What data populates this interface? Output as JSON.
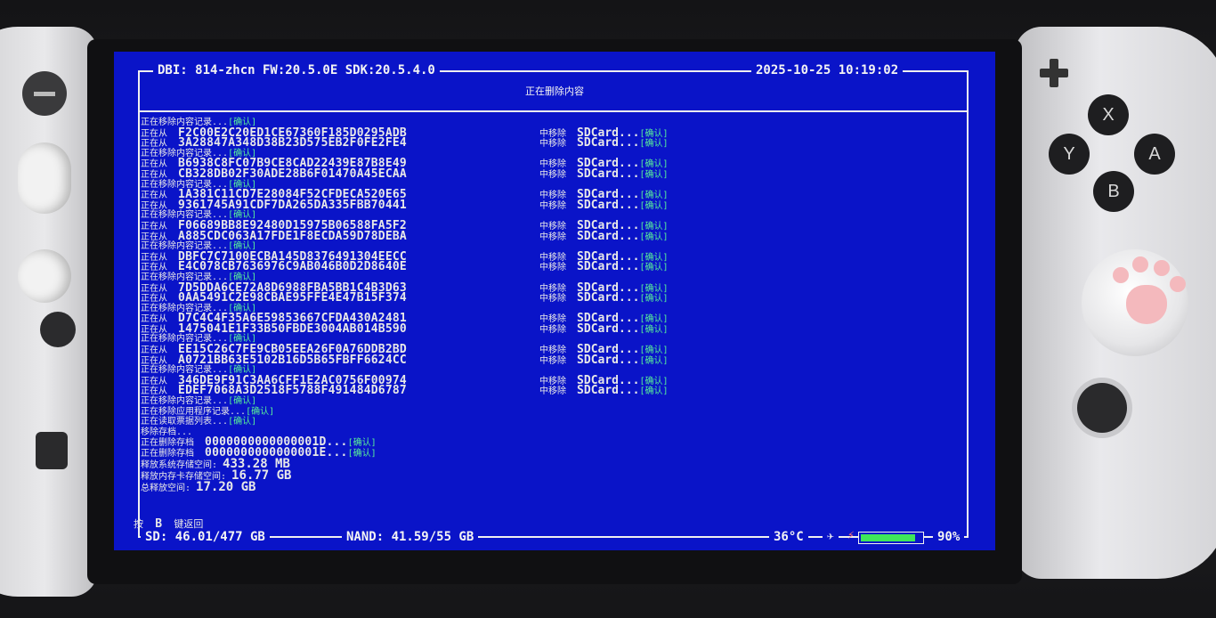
{
  "header": {
    "app_info": "DBI: 814-zhcn FW:20.5.0E SDK:20.5.4.0",
    "datetime": "2025-10-25 10:19:02",
    "subtitle": "正在删除内容"
  },
  "log": {
    "ok": "[确认]",
    "sd_tag": "中移除",
    "sd_target": "SDCard...",
    "groups": [
      {
        "header": "正在移除内容记录...",
        "lines": [
          "F2C00E2C20ED1CE67360F185D0295ADB",
          "3A28847A348D38B23D575EB2F0FE2FE4"
        ]
      },
      {
        "header": "正在移除内容记录...",
        "lines": [
          "B6938C8FC07B9CE8CAD22439E87B8E49",
          "CB328DB02F30ADE28B6F01470A45ECAA"
        ]
      },
      {
        "header": "正在移除内容记录...",
        "lines": [
          "1A381C11CD7E28084F52CFDECA520E65",
          "9361745A91CDF7DA265DA335FBB70441"
        ]
      },
      {
        "header": "正在移除内容记录...",
        "lines": [
          "F06689BB8E92480D15975B06588FA5F2",
          "A885CDC063A17FDE1F8ECDA59D78DEBA"
        ]
      },
      {
        "header": "正在移除内容记录...",
        "lines": [
          "DBFC7C7100ECBA145D8376491304EECC",
          "E4C078CB7636976C9AB046B0D2D8640E"
        ]
      },
      {
        "header": "正在移除内容记录...",
        "lines": [
          "7D5DDA6CE72A8D6988FBA5BB1C4B3D63",
          "0AA5491C2E98CBAE95FFE4E47B15F374"
        ]
      },
      {
        "header": "正在移除内容记录...",
        "lines": [
          "D7C4C4F35A6E59853667CFDA430A2481",
          "1475041E1F33B50FBDE3004AB014B590"
        ]
      },
      {
        "header": "正在移除内容记录...",
        "lines": [
          "EE15C26C7FE9CB05EEA26F0A76DDB2BD",
          "A0721BB63E5102B16D5B65FBFF6624CC"
        ]
      },
      {
        "header": "正在移除内容记录...",
        "lines": [
          "346DE9F91C3AA6CFF1E2AC0756F00974",
          "EDEF7068A3D2518F5788F491484D6787"
        ]
      }
    ],
    "line_prefix": "正在从",
    "tail": [
      "正在移除内容记录...",
      "正在移除应用程序记录...",
      "正在读取票据列表..."
    ],
    "saves_header": "移除存档...",
    "saves_prefix": "正在删除存档",
    "saves": [
      "0000000000000001D...",
      "0000000000000001E..."
    ],
    "freed": [
      {
        "label": "释放系统存储空间:",
        "value": "433.28 MB"
      },
      {
        "label": "释放内存卡存储空间:",
        "value": "16.77 GB"
      },
      {
        "label": "总释放空间:",
        "value": "17.20 GB"
      }
    ]
  },
  "hint": {
    "prefix": "按",
    "key": "B",
    "suffix": "键返回"
  },
  "footer": {
    "storage": "SD: 46.01/477 GB",
    "nand": "NAND: 41.59/55 GB",
    "temp": "36°C",
    "battery_pct": "90%",
    "battery_level": 0.9,
    "battery_glyph": "5"
  },
  "device": {
    "buttons": [
      "X",
      "Y",
      "A",
      "B"
    ]
  },
  "colors": {
    "screen_bg": "#0a14c8",
    "ok_green": "#58f09a",
    "battery_green": "#3ee65a"
  }
}
